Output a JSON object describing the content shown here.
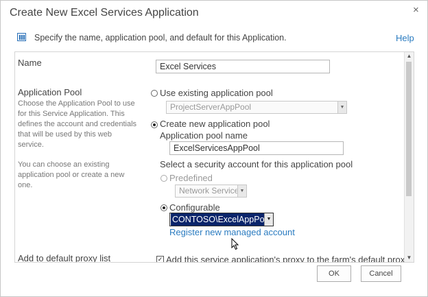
{
  "dialog": {
    "title": "Create New Excel Services Application",
    "close_label": "×",
    "description": "Specify the name, application pool, and default for this Application.",
    "help_label": "Help"
  },
  "name_section": {
    "label": "Name",
    "value": "Excel Services"
  },
  "pool_section": {
    "label": "Application Pool",
    "description_lines": [
      "Choose the Application Pool to use",
      "for this Service Application.  This",
      "defines the account and credentials",
      "that will be used by this web",
      "service."
    ],
    "description2_lines": [
      "You can choose an existing",
      "application pool or create a new",
      "one."
    ],
    "use_existing_label": "Use existing application pool",
    "existing_pool_value": "ProjectServerAppPool",
    "create_new_label": "Create new application pool",
    "pool_name_label": "Application pool name",
    "pool_name_value": "ExcelServicesAppPool",
    "security_label": "Select a security account for this application pool",
    "predefined_label": "Predefined",
    "predefined_value": "Network Service",
    "configurable_label": "Configurable",
    "configurable_value": "CONTOSO\\ExcelAppPool",
    "register_link": "Register new managed account"
  },
  "proxy_section": {
    "label": "Add to default proxy list",
    "checkbox_label": "Add this service application's proxy to the farm's default proxy",
    "checked": true
  },
  "buttons": {
    "ok": "OK",
    "cancel": "Cancel"
  },
  "icons": [
    "application-icon",
    "close-icon",
    "dropdown-arrow-icon",
    "mouse-cursor-icon"
  ]
}
